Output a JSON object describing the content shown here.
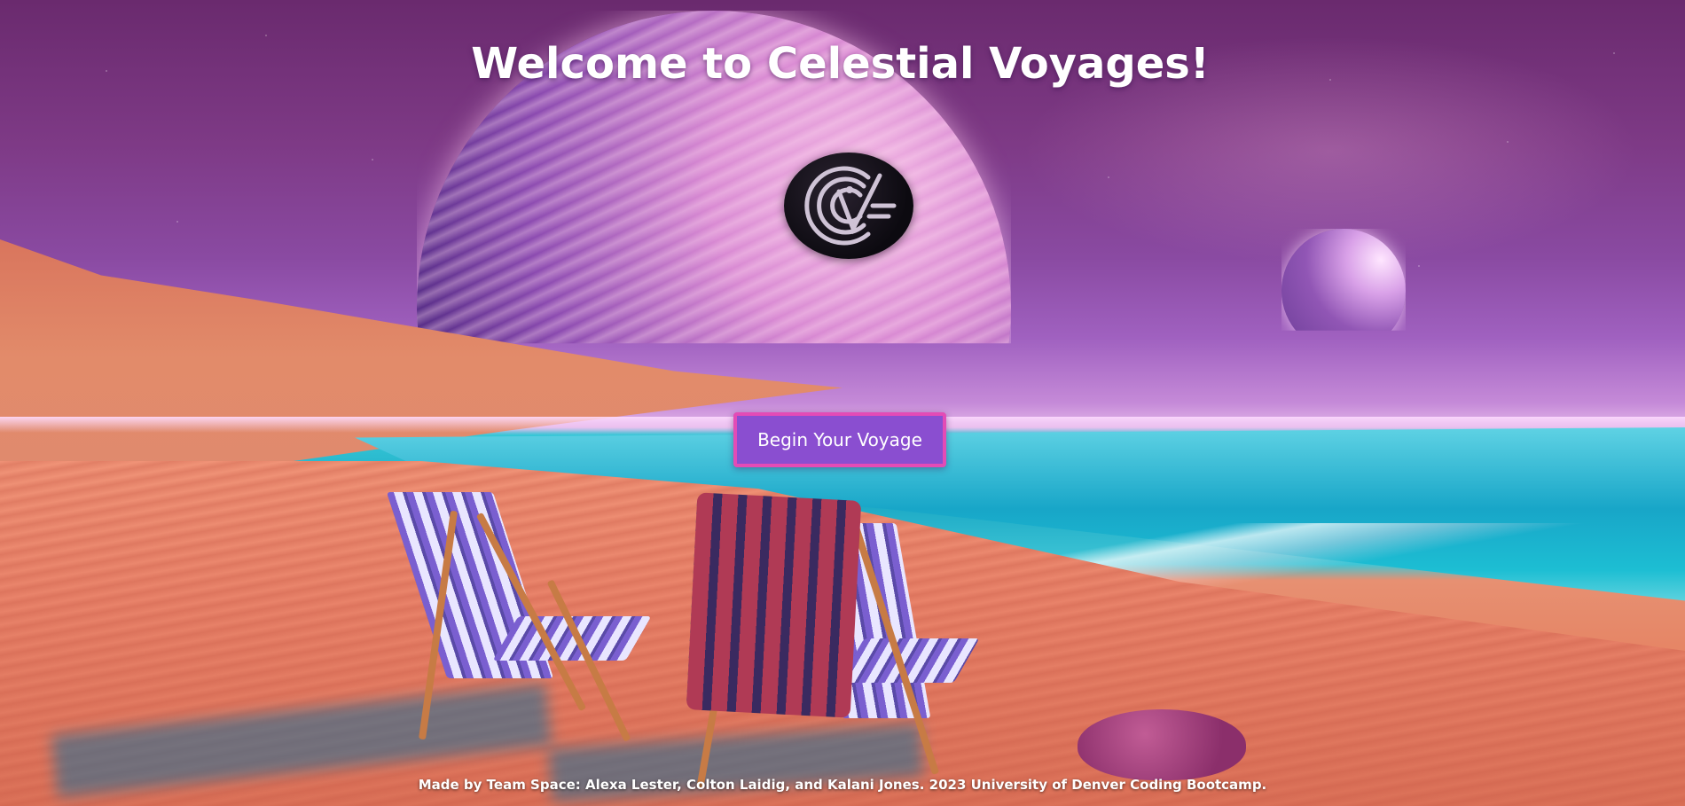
{
  "header": {
    "title": "Welcome to Celestial Voyages!"
  },
  "logo": {
    "icon": "cv-logo-icon"
  },
  "hero": {
    "cta_label": "Begin Your Voyage"
  },
  "footer": {
    "credits": "Made by Team Space: Alexa Lester, Colton Laidig, and Kalani Jones. 2023 University of Denver Coding Bootcamp."
  },
  "colors": {
    "cta_background": "#8a4ed0",
    "cta_border": "#e34bb6",
    "title_text": "#ffffff"
  }
}
